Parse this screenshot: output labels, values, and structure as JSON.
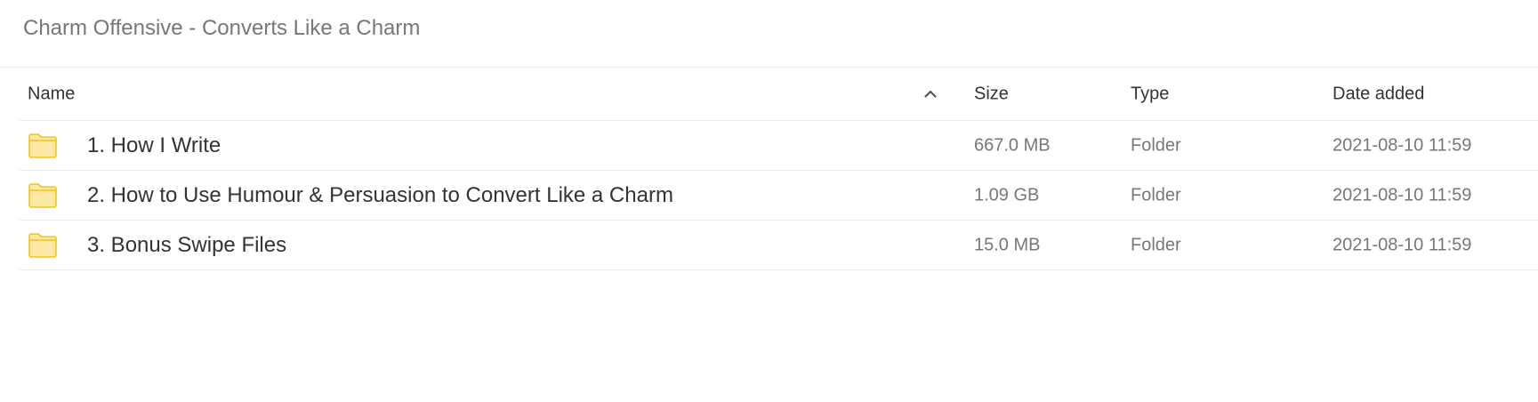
{
  "page": {
    "title": "Charm Offensive - Converts Like a Charm"
  },
  "table": {
    "columns": {
      "name": "Name",
      "size": "Size",
      "type": "Type",
      "date": "Date added"
    },
    "sort_icon": "chevron-up-icon",
    "rows": [
      {
        "icon": "folder-icon",
        "name": "1. How I Write",
        "size": "667.0 MB",
        "type": "Folder",
        "date": "2021-08-10 11:59"
      },
      {
        "icon": "folder-icon",
        "name": "2. How to Use Humour & Persuasion to Convert Like a Charm",
        "size": "1.09 GB",
        "type": "Folder",
        "date": "2021-08-10 11:59"
      },
      {
        "icon": "folder-icon",
        "name": "3. Bonus Swipe Files",
        "size": "15.0 MB",
        "type": "Folder",
        "date": "2021-08-10 11:59"
      }
    ]
  },
  "colors": {
    "folder_fill": "#fde9a6",
    "folder_stroke": "#f3c316",
    "divider": "#ececec",
    "title_text": "#777777",
    "primary_text": "#333333",
    "secondary_text": "#777777"
  }
}
